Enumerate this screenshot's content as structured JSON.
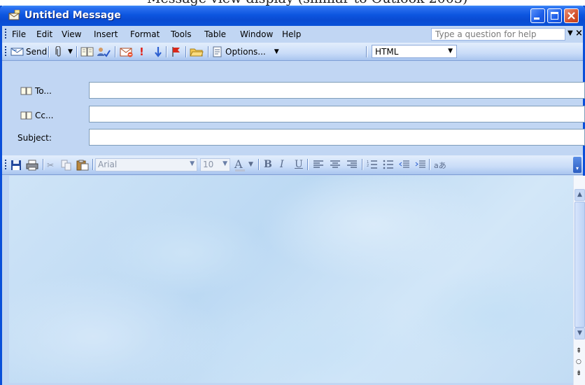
{
  "window": {
    "title": "Untitled Message"
  },
  "menu": {
    "items": [
      "File",
      "Edit",
      "View",
      "Insert",
      "Format",
      "Tools",
      "Table",
      "Window",
      "Help"
    ],
    "help_placeholder": "Type a question for help"
  },
  "toolbar": {
    "send_label": "Send",
    "options_label": "Options...",
    "format_value": "HTML"
  },
  "header": {
    "to_label": "To...",
    "cc_label": "Cc...",
    "subject_label": "Subject:",
    "to_value": "",
    "cc_value": "",
    "subject_value": ""
  },
  "format_toolbar": {
    "font_name": "Arial",
    "font_size": "10"
  },
  "colors": {
    "titlebar": "#0a4fd9",
    "toolbar": "#c1d6f3",
    "body_background": "#c9e0f6"
  }
}
